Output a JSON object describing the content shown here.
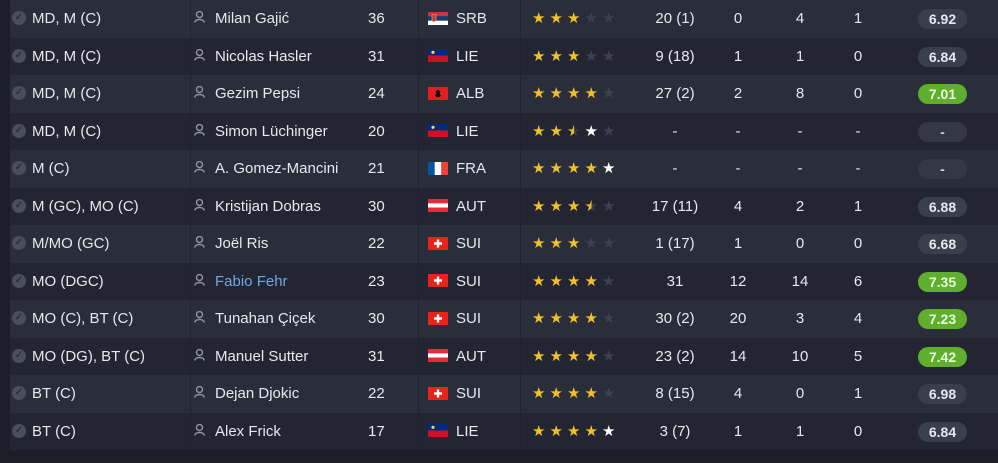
{
  "rows": [
    {
      "position": "MD, M (C)",
      "name": "Milan Gajić",
      "age": "36",
      "flag": "srb",
      "nation": "SRB",
      "stars": [
        1,
        1,
        1,
        0,
        0
      ],
      "apps": "20 (1)",
      "goals": "0",
      "assists": "4",
      "pom": "1",
      "rating": "6.92",
      "rating_style": "normal",
      "highlight": false
    },
    {
      "position": "MD, M (C)",
      "name": "Nicolas Hasler",
      "age": "31",
      "flag": "lie",
      "nation": "LIE",
      "stars": [
        1,
        1,
        1,
        0,
        0
      ],
      "apps": "9 (18)",
      "goals": "1",
      "assists": "1",
      "pom": "0",
      "rating": "6.84",
      "rating_style": "normal",
      "highlight": false
    },
    {
      "position": "MD, M (C)",
      "name": "Gezim Pepsi",
      "age": "24",
      "flag": "alb",
      "nation": "ALB",
      "stars": [
        1,
        1,
        1,
        1,
        0
      ],
      "apps": "27 (2)",
      "goals": "2",
      "assists": "8",
      "pom": "0",
      "rating": "7.01",
      "rating_style": "good",
      "highlight": false
    },
    {
      "position": "MD, M (C)",
      "name": "Simon Lüchinger",
      "age": "20",
      "flag": "lie",
      "nation": "LIE",
      "stars": [
        1,
        1,
        0.5,
        "w",
        0
      ],
      "apps": "-",
      "goals": "-",
      "assists": "-",
      "pom": "-",
      "rating": "-",
      "rating_style": "dash",
      "highlight": false
    },
    {
      "position": "M (C)",
      "name": "A. Gomez-Mancini",
      "age": "21",
      "flag": "fra",
      "nation": "FRA",
      "stars": [
        1,
        1,
        1,
        1,
        "w"
      ],
      "apps": "-",
      "goals": "-",
      "assists": "-",
      "pom": "-",
      "rating": "-",
      "rating_style": "dash",
      "highlight": false
    },
    {
      "position": "M (GC), MO (C)",
      "name": "Kristijan Dobras",
      "age": "30",
      "flag": "aut",
      "nation": "AUT",
      "stars": [
        1,
        1,
        1,
        0.5,
        0
      ],
      "apps": "17 (11)",
      "goals": "4",
      "assists": "2",
      "pom": "1",
      "rating": "6.88",
      "rating_style": "normal",
      "highlight": false
    },
    {
      "position": "M/MO (GC)",
      "name": "Joël Ris",
      "age": "22",
      "flag": "sui",
      "nation": "SUI",
      "stars": [
        1,
        1,
        1,
        0,
        0
      ],
      "apps": "1 (17)",
      "goals": "1",
      "assists": "0",
      "pom": "0",
      "rating": "6.68",
      "rating_style": "normal",
      "highlight": false
    },
    {
      "position": "MO (DGC)",
      "name": "Fabio Fehr",
      "age": "23",
      "flag": "sui",
      "nation": "SUI",
      "stars": [
        1,
        1,
        1,
        1,
        0
      ],
      "apps": "31",
      "goals": "12",
      "assists": "14",
      "pom": "6",
      "rating": "7.35",
      "rating_style": "good",
      "highlight": true
    },
    {
      "position": "MO (C), BT (C)",
      "name": "Tunahan Çiçek",
      "age": "30",
      "flag": "sui",
      "nation": "SUI",
      "stars": [
        1,
        1,
        1,
        1,
        0
      ],
      "apps": "30 (2)",
      "goals": "20",
      "assists": "3",
      "pom": "4",
      "rating": "7.23",
      "rating_style": "good",
      "highlight": false
    },
    {
      "position": "MO (DG), BT (C)",
      "name": "Manuel Sutter",
      "age": "31",
      "flag": "aut",
      "nation": "AUT",
      "stars": [
        1,
        1,
        1,
        1,
        0
      ],
      "apps": "23 (2)",
      "goals": "14",
      "assists": "10",
      "pom": "5",
      "rating": "7.42",
      "rating_style": "good",
      "highlight": false
    },
    {
      "position": "BT (C)",
      "name": "Dejan Djokic",
      "age": "22",
      "flag": "sui",
      "nation": "SUI",
      "stars": [
        1,
        1,
        1,
        1,
        0
      ],
      "apps": "8 (15)",
      "goals": "4",
      "assists": "0",
      "pom": "1",
      "rating": "6.98",
      "rating_style": "normal",
      "highlight": false
    },
    {
      "position": "BT (C)",
      "name": "Alex Frick",
      "age": "17",
      "flag": "lie",
      "nation": "LIE",
      "stars": [
        1,
        1,
        1,
        1,
        "w"
      ],
      "apps": "3 (7)",
      "goals": "1",
      "assists": "1",
      "pom": "0",
      "rating": "6.84",
      "rating_style": "normal",
      "highlight": false
    }
  ],
  "colors": {
    "star": "#f0c02a",
    "good_rating": "#5fae2e",
    "link": "#6ea7e6"
  },
  "icons": {
    "select": "check-circle-icon",
    "player": "person-icon"
  }
}
